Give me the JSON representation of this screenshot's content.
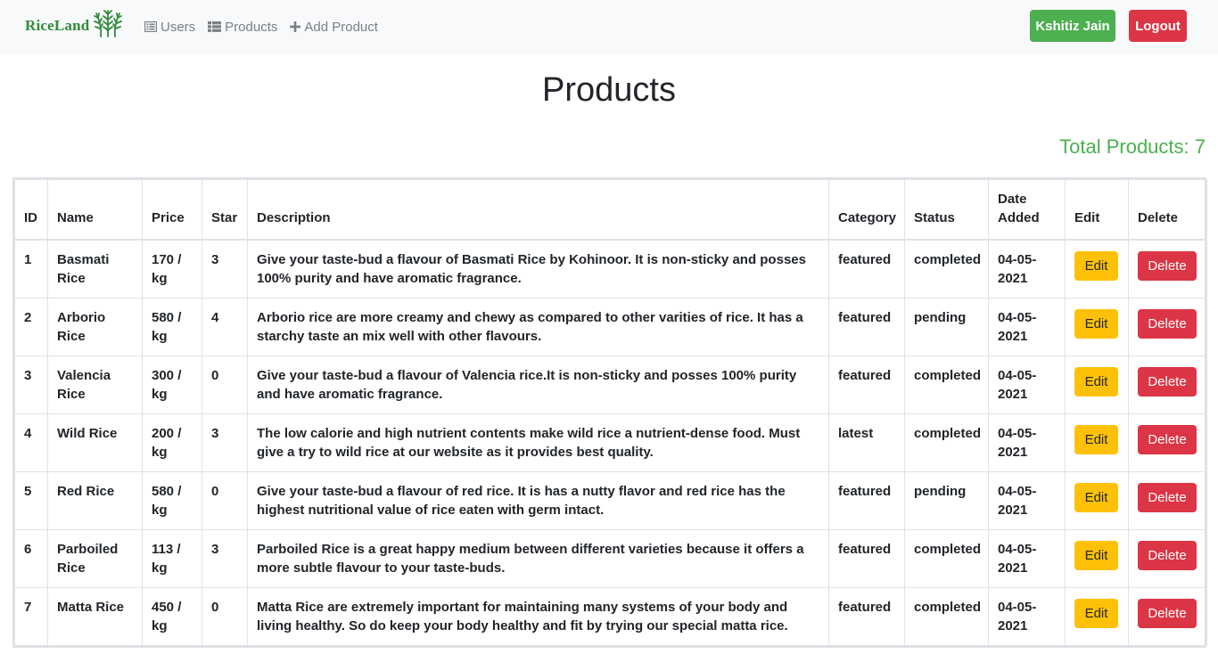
{
  "brand": {
    "name": "RiceLand",
    "logo_icon": "wheat-icon",
    "color": "#2e8b3a"
  },
  "nav": [
    {
      "label": "Users",
      "icon": "list-icon"
    },
    {
      "label": "Products",
      "icon": "table-icon"
    },
    {
      "label": "Add Product",
      "icon": "plus-icon"
    }
  ],
  "user_button": {
    "label": "Kshitiz Jain",
    "color": "#4caf50"
  },
  "logout_button": {
    "label": "Logout",
    "color": "#dc3545"
  },
  "page_title": "Products",
  "total_products": "Total Products: 7",
  "table": {
    "headers": {
      "id": "ID",
      "name": "Name",
      "price": "Price",
      "star": "Star",
      "description": "Description",
      "category": "Category",
      "status": "Status",
      "date_added": "Date Added",
      "edit": "Edit",
      "delete": "Delete"
    },
    "edit_label": "Edit",
    "delete_label": "Delete",
    "rows": [
      {
        "id": "1",
        "name": "Basmati Rice",
        "price": "170 / kg",
        "star": "3",
        "description": "Give your taste-bud a flavour of Basmati Rice by Kohinoor. It is non-sticky and posses 100% purity and have aromatic fragrance.",
        "category": "featured",
        "status": "completed",
        "date_added": "04-05-2021"
      },
      {
        "id": "2",
        "name": "Arborio Rice",
        "price": "580 / kg",
        "star": "4",
        "description": "Arborio rice are more creamy and chewy as compared to other varities of rice. It has a starchy taste an mix well with other flavours.",
        "category": "featured",
        "status": "pending",
        "date_added": "04-05-2021"
      },
      {
        "id": "3",
        "name": "Valencia Rice",
        "price": "300 / kg",
        "star": "0",
        "description": "Give your taste-bud a flavour of Valencia rice.It is non-sticky and posses 100% purity and have aromatic fragrance.",
        "category": "featured",
        "status": "completed",
        "date_added": "04-05-2021"
      },
      {
        "id": "4",
        "name": "Wild Rice",
        "price": "200 / kg",
        "star": "3",
        "description": "The low calorie and high nutrient contents make wild rice a nutrient-dense food. Must give a try to wild rice at our website as it provides best quality.",
        "category": "latest",
        "status": "completed",
        "date_added": "04-05-2021"
      },
      {
        "id": "5",
        "name": "Red Rice",
        "price": "580 / kg",
        "star": "0",
        "description": "Give your taste-bud a flavour of red rice. It is has a nutty flavor and red rice has the highest nutritional value of rice eaten with germ intact.",
        "category": "featured",
        "status": "pending",
        "date_added": "04-05-2021"
      },
      {
        "id": "6",
        "name": "Parboiled Rice",
        "price": "113 / kg",
        "star": "3",
        "description": "Parboiled Rice is a great happy medium between different varieties because it offers a more subtle flavour to your taste-buds.",
        "category": "featured",
        "status": "completed",
        "date_added": "04-05-2021"
      },
      {
        "id": "7",
        "name": "Matta Rice",
        "price": "450 / kg",
        "star": "0",
        "description": "Matta Rice are extremely important for maintaining many systems of your body and living healthy. So do keep your body healthy and fit by trying our special matta rice.",
        "category": "featured",
        "status": "completed",
        "date_added": "04-05-2021"
      }
    ]
  }
}
